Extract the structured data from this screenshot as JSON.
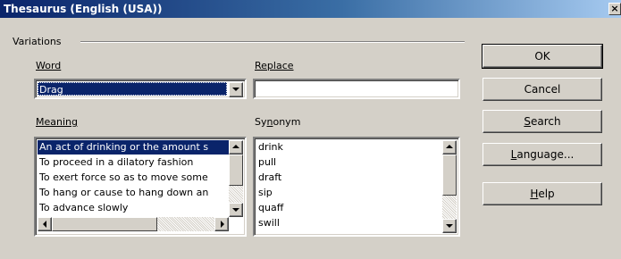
{
  "window": {
    "title": "Thesaurus (English (USA))",
    "close_glyph": "×"
  },
  "group": {
    "label": "Variations"
  },
  "word": {
    "label": "Word",
    "value": "Drag"
  },
  "replace": {
    "label": "Replace",
    "value": ""
  },
  "meaning": {
    "label": "Meaning",
    "items": [
      "An act of drinking or the amount s",
      "To proceed in a dilatory fashion",
      "To exert force so as to move some",
      "To hang or cause to hang down an",
      "To advance slowly"
    ],
    "selected_index": 0
  },
  "synonym": {
    "label": "Synonym",
    "items": [
      "drink",
      "pull",
      "draft",
      "sip",
      "quaff",
      "swill"
    ]
  },
  "buttons": {
    "ok": "OK",
    "cancel": "Cancel",
    "search": "Search",
    "language": "Language...",
    "help": "Help"
  },
  "icons": {
    "close": "close-icon",
    "dropdown": "chevron-down-icon",
    "scroll_up": "arrow-up-icon",
    "scroll_down": "arrow-down-icon",
    "scroll_left": "arrow-left-icon",
    "scroll_right": "arrow-right-icon"
  },
  "colors": {
    "selection": "#0a246a",
    "dialog_bg": "#d4d0c8",
    "title_gradient_start": "#0a246a",
    "title_gradient_end": "#a6caf0"
  }
}
